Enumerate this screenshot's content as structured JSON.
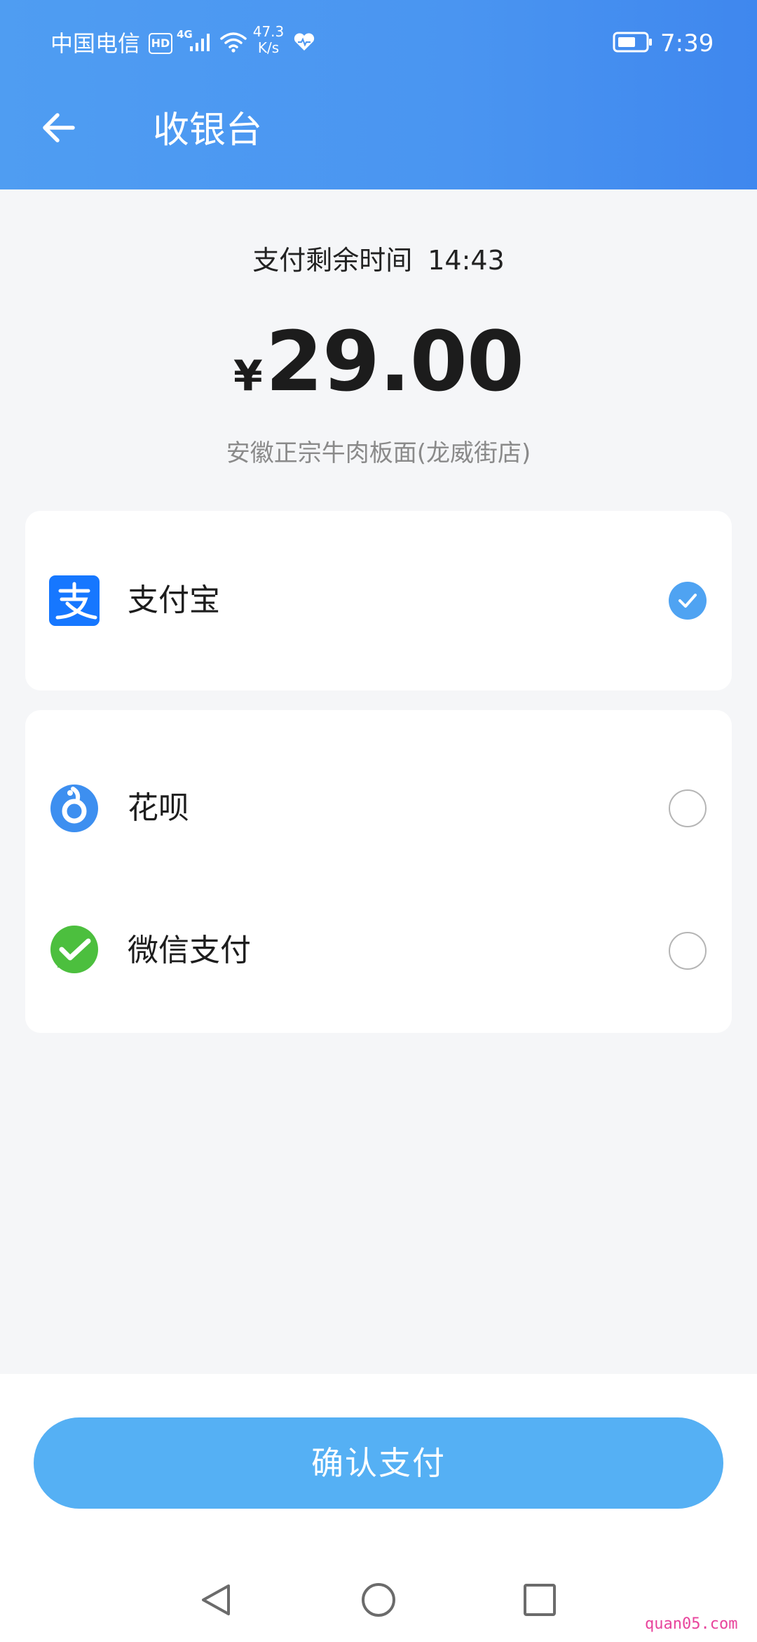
{
  "status_bar": {
    "carrier": "中国电信",
    "hd_badge": "HD",
    "network_type": "4G",
    "speed_value": "47.3",
    "speed_unit": "K/s",
    "time": "7:39",
    "icons": [
      "signal-icon",
      "wifi-icon",
      "heart-icon",
      "battery-icon"
    ]
  },
  "header": {
    "back_icon": "arrow-left-icon",
    "title": "收银台"
  },
  "payment": {
    "countdown_label": "支付剩余时间",
    "countdown_value": "14:43",
    "currency": "¥",
    "amount": "29.00",
    "merchant": "安徽正宗牛肉板面(龙威街店)"
  },
  "methods": [
    {
      "label": "支付宝",
      "icon": "alipay-icon",
      "selected": true
    },
    {
      "label": "花呗",
      "icon": "huabei-icon",
      "selected": false
    },
    {
      "label": "微信支付",
      "icon": "wechat-pay-icon",
      "selected": false
    }
  ],
  "confirm_button": {
    "label": "确认支付"
  },
  "nav_bar": {
    "icons": [
      "nav-back-icon",
      "nav-home-icon",
      "nav-recent-icon"
    ]
  },
  "watermark": "quan05.com",
  "colors": {
    "header": "#4a95f1",
    "accent": "#4fa3f2",
    "button": "#55b0f4",
    "alipay": "#1677ff",
    "wechat": "#4cbf3e"
  }
}
